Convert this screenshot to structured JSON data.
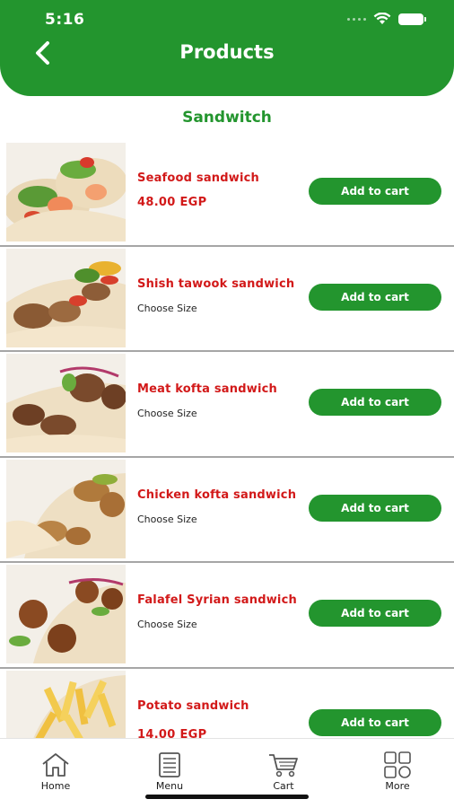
{
  "status_bar": {
    "time": "5:16"
  },
  "header": {
    "title": "Products",
    "back_icon": "chevron-left-icon"
  },
  "section": {
    "title": "Sandwitch"
  },
  "products": [
    {
      "name": "Seafood sandwich",
      "price": "48.00 EGP",
      "size_label": "",
      "button": "Add to cart"
    },
    {
      "name": "Shish tawook sandwich",
      "price": "",
      "size_label": "Choose Size",
      "button": "Add to cart"
    },
    {
      "name": "Meat kofta sandwich",
      "price": "",
      "size_label": "Choose Size",
      "button": "Add to cart"
    },
    {
      "name": "Chicken kofta sandwich",
      "price": "",
      "size_label": "Choose Size",
      "button": "Add to cart"
    },
    {
      "name": "Falafel Syrian sandwich",
      "price": "",
      "size_label": "Choose Size",
      "button": "Add to cart"
    },
    {
      "name": "Potato sandwich",
      "price": "14.00 EGP",
      "size_label": "",
      "button": "Add to cart"
    }
  ],
  "bottom_nav": {
    "items": [
      {
        "label": "Home",
        "icon": "home-icon"
      },
      {
        "label": "Menu",
        "icon": "menu-icon"
      },
      {
        "label": "Cart",
        "icon": "cart-icon"
      },
      {
        "label": "More",
        "icon": "more-icon"
      }
    ]
  },
  "colors": {
    "brand_green": "#23952e",
    "price_red": "#d21919",
    "divider": "#a6a6a6"
  }
}
